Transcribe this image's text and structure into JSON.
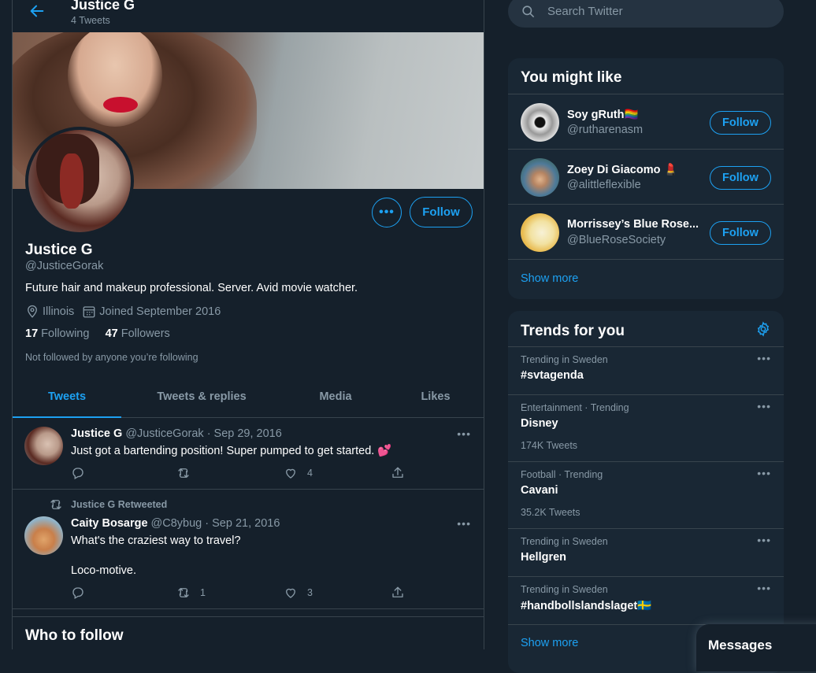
{
  "header": {
    "title": "Justice G",
    "subtitle": "4 Tweets"
  },
  "profile": {
    "name": "Justice G",
    "handle": "@JusticeGorak",
    "bio": "Future hair and makeup professional. Server. Avid movie watcher.",
    "location": "Illinois",
    "joined": "Joined September 2016",
    "following_count": "17",
    "following_label": "Following",
    "followers_count": "47",
    "followers_label": "Followers",
    "not_followed": "Not followed by anyone you’re following",
    "follow_label": "Follow",
    "more_label": "•••"
  },
  "tabs": [
    "Tweets",
    "Tweets & replies",
    "Media",
    "Likes"
  ],
  "tweets": [
    {
      "name": "Justice G",
      "handle": "@JusticeGorak",
      "date": "· Sep 29, 2016",
      "text": "Just got a bartending position! Super pumped to get started. 💕",
      "likes": "4",
      "retweets": ""
    },
    {
      "retweeted_by": "Justice G Retweeted",
      "name": "Caity Bosarge",
      "handle": "@C8ybug",
      "date": "· Sep 21, 2016",
      "text_line1": "What's the craziest way to travel?",
      "text_line2": "Loco-motive.",
      "retweets": "1",
      "likes": "3"
    }
  ],
  "who_to_follow": "Who to follow",
  "search": {
    "placeholder": "Search Twitter"
  },
  "you_might_like": {
    "title": "You might like",
    "users": [
      {
        "name": "Soy gRuth🏳️‍🌈",
        "handle": "@rutharenasm",
        "button": "Follow"
      },
      {
        "name": "Zoey Di Giacomo 💄",
        "handle": "@alittleflexible",
        "button": "Follow"
      },
      {
        "name": "Morrissey’s Blue Rose...",
        "handle": "@BlueRoseSociety",
        "button": "Follow"
      }
    ],
    "show_more": "Show more"
  },
  "trends": {
    "title": "Trends for you",
    "items": [
      {
        "context": "Trending in Sweden",
        "name": "#svtagenda",
        "count": ""
      },
      {
        "context": "Entertainment · Trending",
        "name": "Disney",
        "count": "174K Tweets"
      },
      {
        "context": "Football · Trending",
        "name": "Cavani",
        "count": "35.2K Tweets"
      },
      {
        "context": "Trending in Sweden",
        "name": "Hellgren",
        "count": ""
      },
      {
        "context": "Trending in Sweden",
        "name": "#handbollslandslaget🇸🇪",
        "count": ""
      }
    ],
    "show_more": "Show more"
  },
  "messages": {
    "label": "Messages"
  },
  "dots": "•••",
  "colors": {
    "background": "#15202b",
    "card": "#192734",
    "accent": "#1da1f2",
    "secondary_text": "#8899a6",
    "border": "#38444d"
  }
}
